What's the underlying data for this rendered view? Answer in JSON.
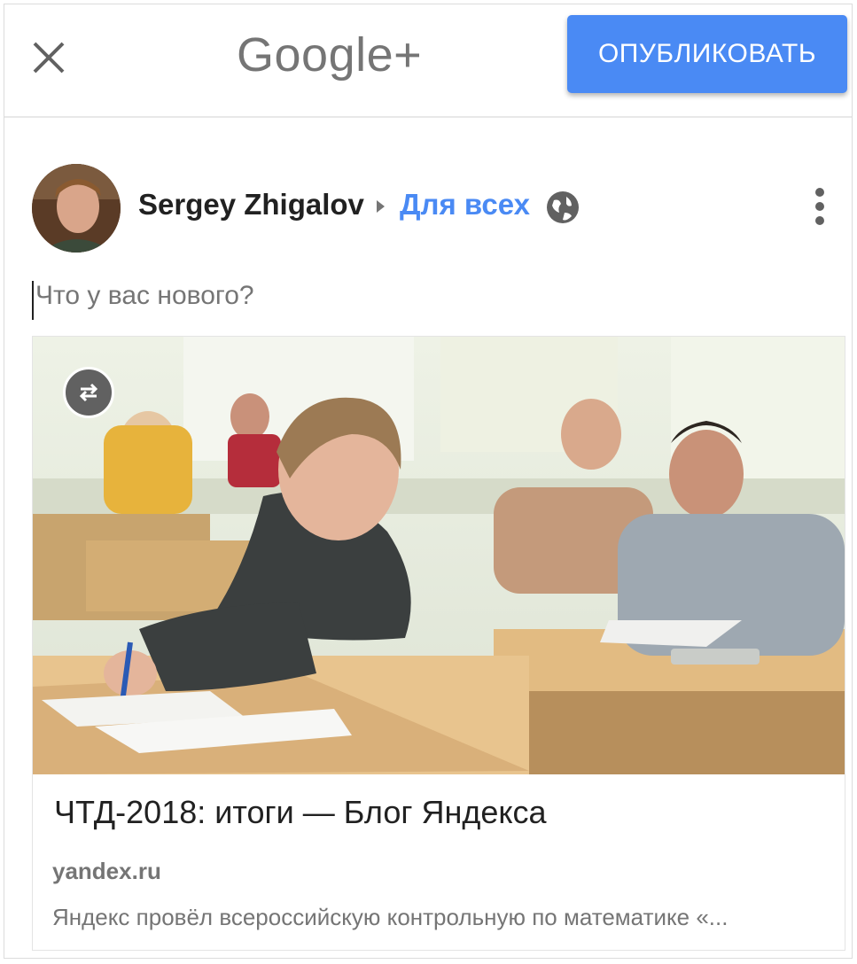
{
  "header": {
    "logo_text": "Google+",
    "publish_label": "ОПУБЛИКОВАТЬ",
    "accent_color": "#4a8af4"
  },
  "post": {
    "author_name": "Sergey Zhigalov",
    "audience_label": "Для всех",
    "compose_placeholder": "Что у вас нового?"
  },
  "link_card": {
    "title": "ЧТД-2018: итоги — Блог Яндекса",
    "domain": "yandex.ru",
    "description": "Яндекс провёл всероссийскую контрольную по математике «..."
  },
  "icons": [
    "close-icon",
    "arrow-right-icon",
    "globe-icon",
    "more-vert-icon",
    "swap-icon"
  ]
}
